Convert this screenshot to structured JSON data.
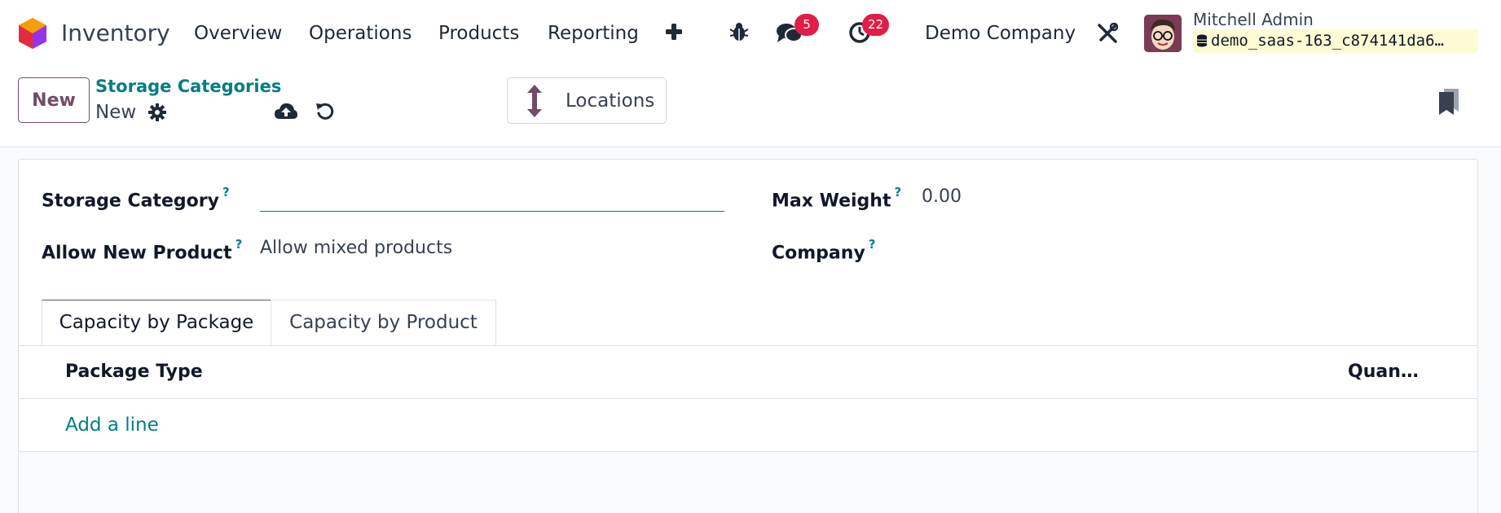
{
  "navbar": {
    "app_name": "Inventory",
    "menu": [
      "Overview",
      "Operations",
      "Products",
      "Reporting"
    ],
    "add_icon": "plus-icon",
    "debug_icon": "bug-icon",
    "messages_icon": "chat-icon",
    "messages_count": "5",
    "activities_icon": "clock-icon",
    "activities_count": "22",
    "company": "Demo Company",
    "settings_icon": "tools-icon",
    "user_name": "Mitchell Admin",
    "database": "demo_saas-163_c874141da6…"
  },
  "control_panel": {
    "new_button": "New",
    "breadcrumb": "Storage Categories",
    "record_name": "New",
    "gear_icon": "gear-icon",
    "save_icon": "cloud-upload-icon",
    "discard_icon": "undo-icon",
    "locations_button": "Locations",
    "locations_icon": "arrows-vertical-icon",
    "bookmark_icon": "bookmark-icon"
  },
  "form": {
    "storage_category_label": "Storage Category",
    "storage_category_value": "",
    "allow_new_product_label": "Allow New Product",
    "allow_new_product_value": "Allow mixed products",
    "max_weight_label": "Max Weight",
    "max_weight_value": "0.00",
    "company_label": "Company",
    "help_mark": "?"
  },
  "tabs": [
    {
      "label": "Capacity by Package",
      "active": true
    },
    {
      "label": "Capacity by Product",
      "active": false
    }
  ],
  "table": {
    "columns": [
      "Package Type",
      "Quan…"
    ],
    "add_line": "Add a line"
  },
  "colors": {
    "brand": "#714b67",
    "link": "#017e84",
    "badge": "#e11d48"
  }
}
